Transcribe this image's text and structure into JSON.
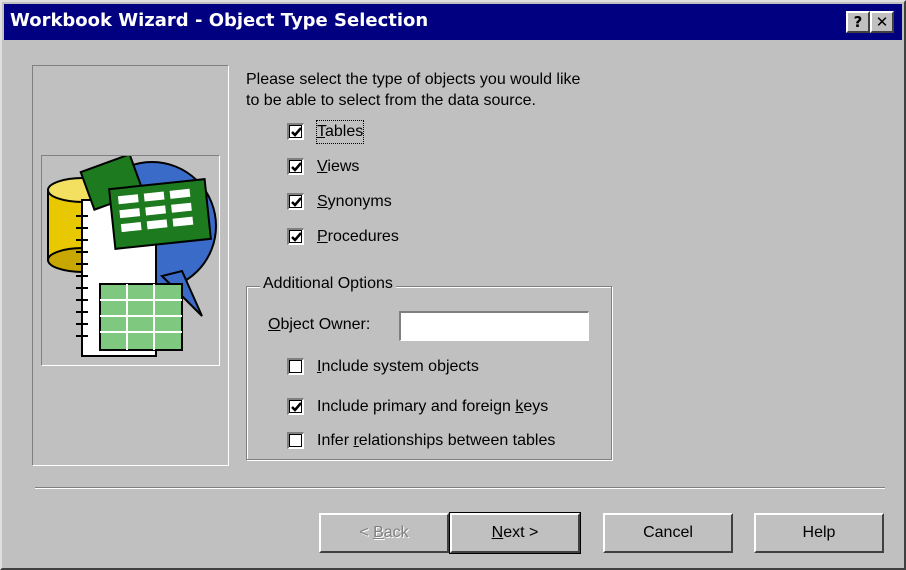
{
  "window": {
    "title": "Workbook Wizard - Object Type Selection"
  },
  "titlebar": {
    "help_glyph": "?",
    "close_glyph": "✕"
  },
  "prompt": {
    "line1": "Please select the type of objects you would like",
    "line2": "to be able to select from the data source."
  },
  "object_types": [
    {
      "label": "Tables",
      "mnemonic": "T",
      "rest": "ables",
      "checked": true
    },
    {
      "label": "Views",
      "mnemonic": "V",
      "rest": "iews",
      "checked": true
    },
    {
      "label": "Synonyms",
      "mnemonic": "S",
      "rest": "ynonyms",
      "checked": true
    },
    {
      "label": "Procedures",
      "mnemonic": "P",
      "rest": "rocedures",
      "checked": true
    }
  ],
  "additional_options": {
    "group_label": "Additional Options",
    "owner": {
      "mnemonic": "O",
      "rest": "bject Owner:",
      "value": ""
    },
    "options": [
      {
        "pre": "",
        "mnemonic": "I",
        "rest": "nclude system objects",
        "checked": false
      },
      {
        "pre": "Include primary and foreign ",
        "mnemonic": "k",
        "rest": "eys",
        "checked": true
      },
      {
        "pre": "Infer ",
        "mnemonic": "r",
        "rest": "elationships between tables",
        "checked": false
      }
    ]
  },
  "buttons": {
    "back": {
      "pre": "< ",
      "mnemonic": "B",
      "rest": "ack",
      "enabled": false
    },
    "next": {
      "mnemonic": "N",
      "rest": "ext >"
    },
    "cancel": "Cancel",
    "help": "Help"
  },
  "colors": {
    "titlebar": "#000080",
    "face": "#c0c0c0",
    "shadow": "#808080",
    "green": "#1e7a1e",
    "blue": "#3a6bc8",
    "yellow": "#e8c800"
  }
}
